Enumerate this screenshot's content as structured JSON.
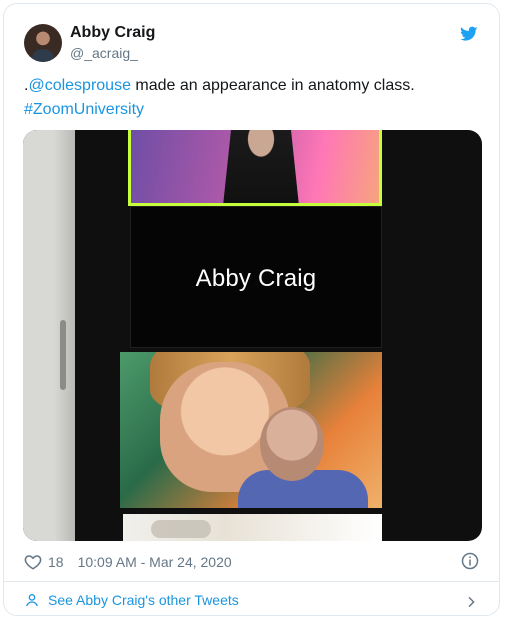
{
  "author": {
    "name": "Abby Craig",
    "handle": "@_acraig_"
  },
  "tweet": {
    "text_pre": ".",
    "mention": "@colesprouse",
    "text_post": " made an appearance in anatomy class.",
    "hashtag": "#ZoomUniversity"
  },
  "media": {
    "tile_name": "Abby Craig"
  },
  "meta": {
    "likes": "18",
    "timestamp": "10:09 AM - Mar 24, 2020"
  },
  "footer": {
    "cta": "See Abby Craig's other Tweets"
  },
  "icons": {
    "brand": "twitter-bird-icon",
    "like": "heart-icon",
    "info": "info-icon",
    "profile": "person-icon",
    "navigate": "chevron-right-icon"
  },
  "colors": {
    "brand_blue": "#1b95e0",
    "muted": "#657786",
    "border": "#e1e8ed"
  }
}
